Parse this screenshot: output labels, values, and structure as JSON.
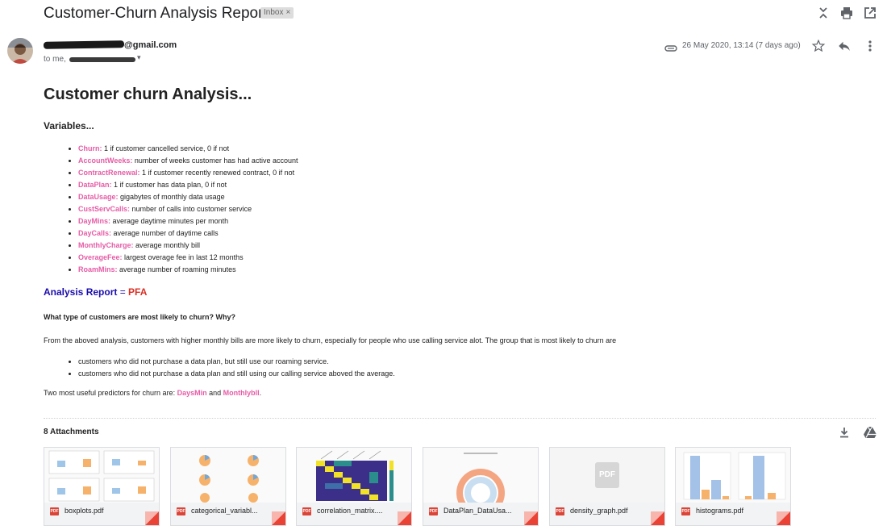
{
  "email": {
    "subject": "Customer-Churn Analysis Report",
    "label": "Inbox",
    "label_remove": "×",
    "sender_domain": "@gmail.com",
    "to_prefix": "to me, ",
    "to_caret": "▾",
    "date": "26 May 2020, 13:14 (7 days ago)"
  },
  "body": {
    "heading": "Customer churn Analysis...",
    "variables_heading": "Variables...",
    "variables": [
      {
        "name": "Churn:",
        "desc": " 1 if customer cancelled service, 0 if not"
      },
      {
        "name": "AccountWeeks:",
        "desc": " number of weeks customer has had active account"
      },
      {
        "name": "ContractRenewal:",
        "desc": " 1 if customer recently renewed contract, 0 if not"
      },
      {
        "name": "DataPlan:",
        "desc": " 1 if customer has data plan, 0 if not"
      },
      {
        "name": "DataUsage:",
        "desc": " gigabytes of monthly data usage"
      },
      {
        "name": "CustServCalls:",
        "desc": " number of calls into customer service"
      },
      {
        "name": "DayMins:",
        "desc": " average daytime minutes per month"
      },
      {
        "name": "DayCalls:",
        "desc": " average number of daytime calls"
      },
      {
        "name": "MonthlyCharge:",
        "desc": " average monthly bill"
      },
      {
        "name": "OverageFee:",
        "desc": " largest overage fee in last 12 months"
      },
      {
        "name": "RoamMins:",
        "desc": " average number of roaming minutes"
      }
    ],
    "report_label": "Analysis Report",
    "report_eq": " = ",
    "report_value": "PFA",
    "question": "What type of customers are most likely to churn? Why?",
    "paragraph": "From the aboved analysis, customers with higher monthly bills are more likely to churn, especially for people who use calling service alot. The group that is most likely to churn are",
    "groups": [
      "customers who did not purchase a data plan, but still use our roaming service.",
      "customers who did not purchase a data plan and still using our calling service aboved the average."
    ],
    "predictors_prefix": "Two most useful predictors for churn are: ",
    "predictor_1": "DaysMin",
    "predictors_and": " and ",
    "predictor_2": "Monthlybll",
    "predictors_suffix": "."
  },
  "attachments": {
    "title": "8 Attachments",
    "pdf_label": "PDF",
    "items": [
      {
        "name": "boxplots.pdf"
      },
      {
        "name": "categorical_variabl..."
      },
      {
        "name": "correlation_matrix...."
      },
      {
        "name": "DataPlan_DataUsa..."
      },
      {
        "name": "density_graph.pdf"
      },
      {
        "name": "histograms.pdf"
      }
    ]
  },
  "colors": {
    "variable_pink": "#e65ca6",
    "report_blue": "#1a0dab",
    "pfa_red": "#d93025",
    "pdf_red": "#db4437"
  },
  "icons": {
    "header": [
      "expand-collapse-icon",
      "print-icon",
      "open-new-window-icon"
    ],
    "message": [
      "attachment-icon",
      "star-icon",
      "reply-icon",
      "more-vert-icon"
    ],
    "attachments": [
      "download-all-icon",
      "save-to-drive-icon"
    ]
  }
}
